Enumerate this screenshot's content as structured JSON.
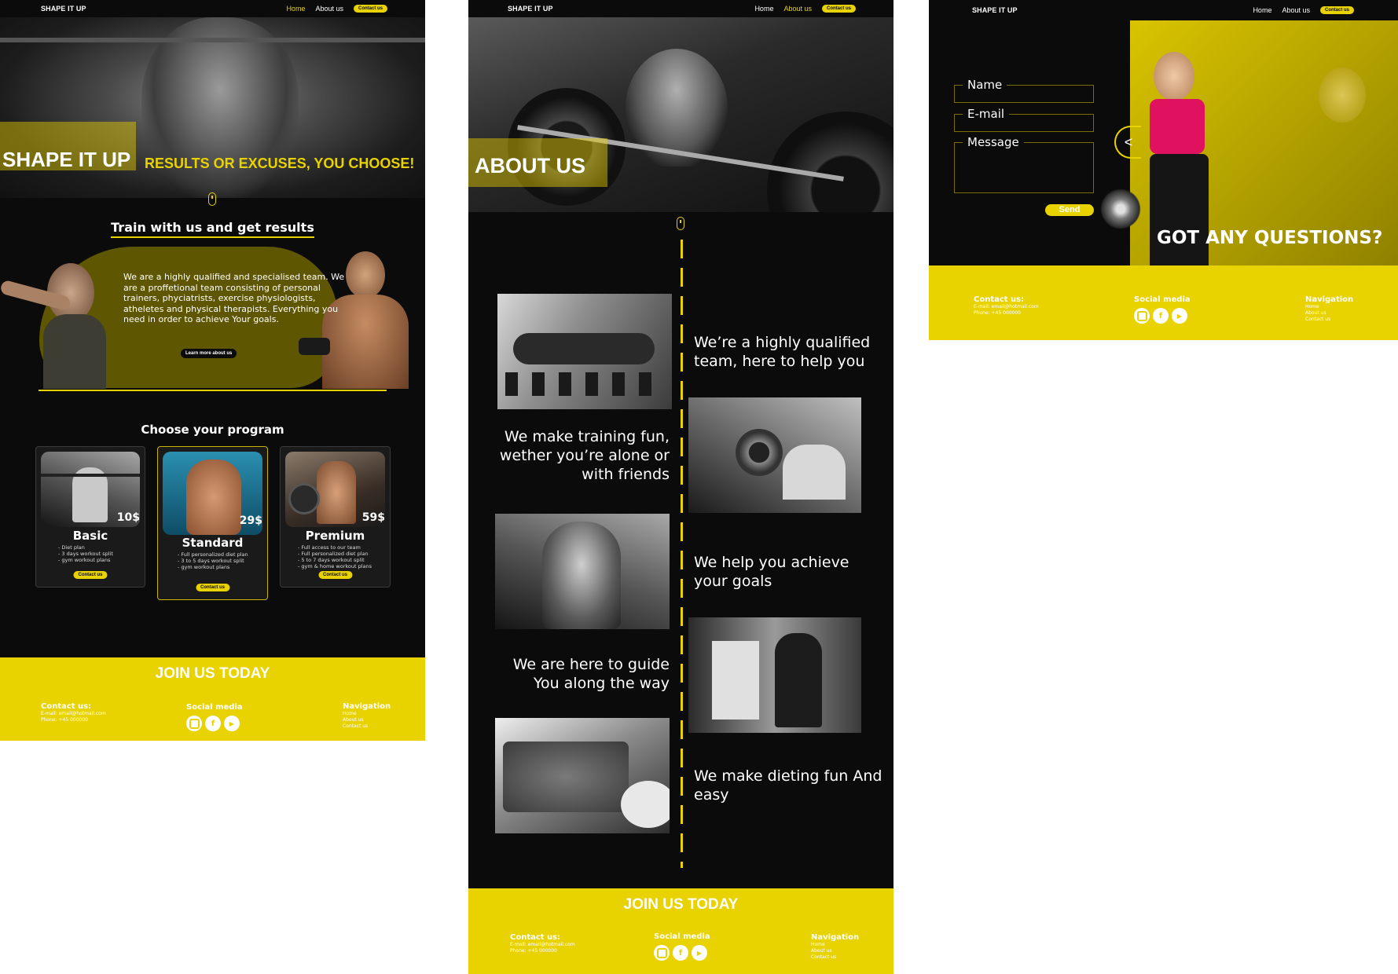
{
  "brand": "SHAPE IT UP",
  "nav": {
    "home": "Home",
    "about": "About us",
    "contact": "Contact us"
  },
  "colors": {
    "accent": "#e8d200",
    "background": "#0b0b0b",
    "footer": "#e8d200"
  },
  "home": {
    "hero_title": "SHAPE IT UP",
    "hero_tagline": "RESULTS OR EXCUSES, YOU CHOOSE!",
    "section_heading": "Train with us and get results",
    "team_text": "We are a highly qualified and specialised team. We are a proffetional team consisting of personal trainers, phyciatrists, exercise physiologists, atheletes and physical therapists. Everything you need in order to achieve Your goals.",
    "learn_more": "Learn more about us",
    "programs_heading": "Choose your program",
    "programs": [
      {
        "name": "Basic",
        "price": "10$",
        "features": [
          "- Diet plan",
          "- 3 days workout split",
          "- gym workout plans"
        ],
        "cta": "Contact us"
      },
      {
        "name": "Standard",
        "price": "29$",
        "features": [
          "- Full personalized diet plan",
          "- 3 to 5 days workout split",
          "- gym workout plans"
        ],
        "cta": "Contact us"
      },
      {
        "name": "Premium",
        "price": "59$",
        "features": [
          "- Full access to our team",
          "- Full personalized diet plan",
          "- 5 to 7 days workout split",
          "- gym & home workout plans"
        ],
        "cta": "Contact us"
      }
    ]
  },
  "about": {
    "hero_title": "ABOUT US",
    "items": [
      "We’re a highly qualified team, here to help you",
      "We make training fun, wether you’re alone or with friends",
      "We help you achieve your goals",
      "We are here to guide You along the way",
      "We make dieting fun And easy"
    ]
  },
  "contact": {
    "name_label": "Name",
    "email_label": "E-mail",
    "message_label": "Message",
    "send": "Send",
    "arrow": "<",
    "headline": "GOT ANY QUESTIONS?"
  },
  "footer": {
    "join": "JOIN US TODAY",
    "contact_heading": "Contact us:",
    "email": "E-mail: email@hotmail.com",
    "phone": "Phone: +45 000000",
    "social_heading": "Social media",
    "nav_heading": "Navigation",
    "nav_items": [
      "Home",
      "About us",
      "Contact us"
    ]
  }
}
